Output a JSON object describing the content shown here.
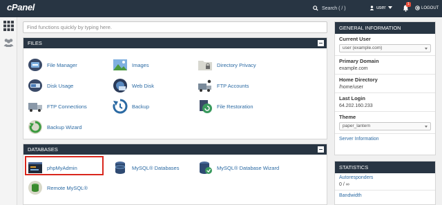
{
  "topbar": {
    "logo": "cPanel",
    "search_placeholder": "Search ( / )",
    "user": "user",
    "notification_count": "1",
    "logout": "LOGOUT"
  },
  "search": {
    "placeholder": "Find functions quickly by typing here."
  },
  "files": {
    "title": "FILES",
    "items": [
      "File Manager",
      "Images",
      "Directory Privacy",
      "Disk Usage",
      "Web Disk",
      "FTP Accounts",
      "FTP Connections",
      "Backup",
      "File Restoration",
      "Backup Wizard"
    ]
  },
  "databases": {
    "title": "DATABASES",
    "items": [
      "phpMyAdmin",
      "MySQL® Databases",
      "MySQL® Database Wizard",
      "Remote MySQL®"
    ]
  },
  "general": {
    "title": "GENERAL INFORMATION",
    "current_user_label": "Current User",
    "current_user_value": "user (example.com)",
    "primary_domain_label": "Primary Domain",
    "primary_domain_value": "example.com",
    "home_dir_label": "Home Directory",
    "home_dir_value": "/home/user",
    "last_login_label": "Last Login",
    "last_login_value": "64.202.160.233",
    "theme_label": "Theme",
    "theme_value": "paper_lantern",
    "server_info": "Server Information"
  },
  "stats": {
    "title": "STATISTICS",
    "autoresponders_label": "Autoresponders",
    "autoresponders_value": "0 / ∞",
    "bandwidth_label": "Bandwidth"
  },
  "colors": {
    "navy": "#283543",
    "link": "#2b6aa3",
    "highlight": "#d9261c"
  }
}
